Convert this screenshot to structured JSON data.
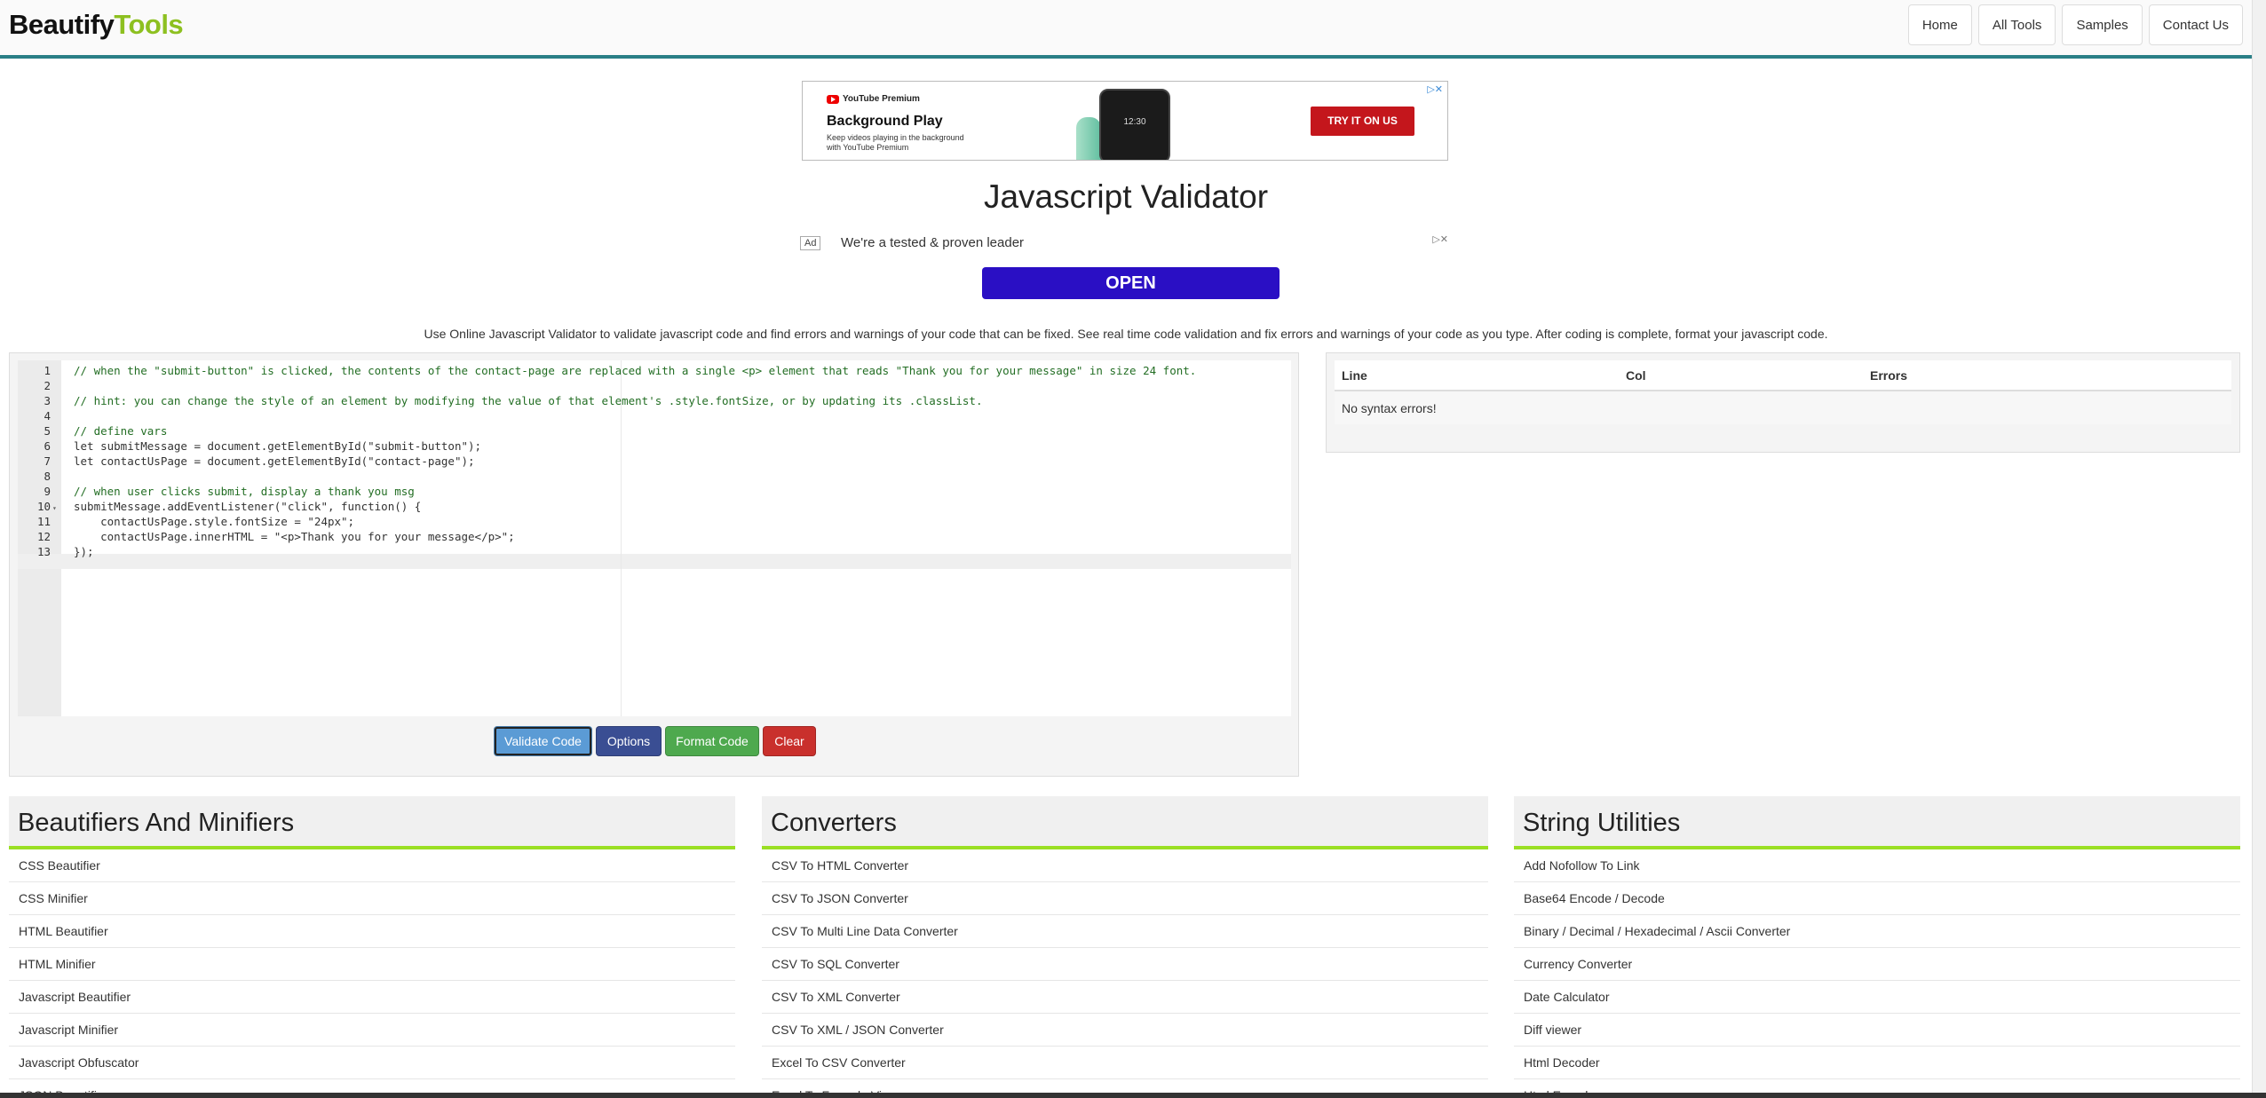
{
  "header": {
    "logo_a": "Beautify",
    "logo_b": "Tools",
    "nav": [
      "Home",
      "All Tools",
      "Samples",
      "Contact Us"
    ]
  },
  "ad_top": {
    "brand": "YouTube Premium",
    "headline": "Background Play",
    "subtext": "Keep videos playing in the background with YouTube Premium",
    "phone_time": "12:30",
    "cta": "TRY IT ON US"
  },
  "page_title": "Javascript Validator",
  "ad_mid": {
    "label": "Ad",
    "text": "We're a tested & proven leader",
    "cta": "OPEN"
  },
  "description": "Use Online Javascript Validator to validate javascript code and find errors and warnings of your code that can be fixed. See real time code validation and fix errors and warnings of your code as you type. After coding is complete, format your javascript code.",
  "editor": {
    "line_numbers": [
      "1",
      "2",
      "3",
      "4",
      "5",
      "6",
      "7",
      "8",
      "9",
      "10",
      "11",
      "12",
      "13"
    ],
    "lines": [
      "// when the \"submit-button\" is clicked, the contents of the contact-page are replaced with a single <p> element that reads \"Thank you for your message\" in size 24 font.",
      "",
      "// hint: you can change the style of an element by modifying the value of that element's .style.fontSize, or by updating its .classList.",
      "",
      "// define vars",
      "let submitMessage = document.getElementById(\"submit-button\");",
      "let contactUsPage = document.getElementById(\"contact-page\");",
      "",
      "// when user clicks submit, display a thank you msg",
      "submitMessage.addEventListener(\"click\", function() {",
      "    contactUsPage.style.fontSize = \"24px\";",
      "    contactUsPage.innerHTML = \"<p>Thank you for your message</p>\";",
      "});"
    ]
  },
  "buttons": {
    "validate": "Validate Code",
    "options": "Options",
    "format": "Format Code",
    "clear": "Clear"
  },
  "results": {
    "columns": [
      "Line",
      "Col",
      "Errors"
    ],
    "message": "No syntax errors!"
  },
  "categories": [
    {
      "title": "Beautifiers And Minifiers",
      "items": [
        "CSS Beautifier",
        "CSS Minifier",
        "HTML Beautifier",
        "HTML Minifier",
        "Javascript Beautifier",
        "Javascript Minifier",
        "Javascript Obfuscator",
        "JSON Beautifier"
      ]
    },
    {
      "title": "Converters",
      "items": [
        "CSV To HTML Converter",
        "CSV To JSON Converter",
        "CSV To Multi Line Data Converter",
        "CSV To SQL Converter",
        "CSV To XML Converter",
        "CSV To XML / JSON Converter",
        "Excel To CSV Converter",
        "Excel To Formula View"
      ]
    },
    {
      "title": "String Utilities",
      "items": [
        "Add Nofollow To Link",
        "Base64 Encode / Decode",
        "Binary / Decimal / Hexadecimal / Ascii Converter",
        "Currency Converter",
        "Date Calculator",
        "Diff viewer",
        "Html Decoder",
        "Html Encoder"
      ]
    }
  ],
  "colors": {
    "brand_green": "#8dc020",
    "teal_border": "#2a7f86",
    "validate_btn": "#5b9bd5",
    "options_btn": "#3a4e93",
    "format_btn": "#4ea94e",
    "clear_btn": "#c9302c",
    "category_underline": "#9adf24"
  }
}
